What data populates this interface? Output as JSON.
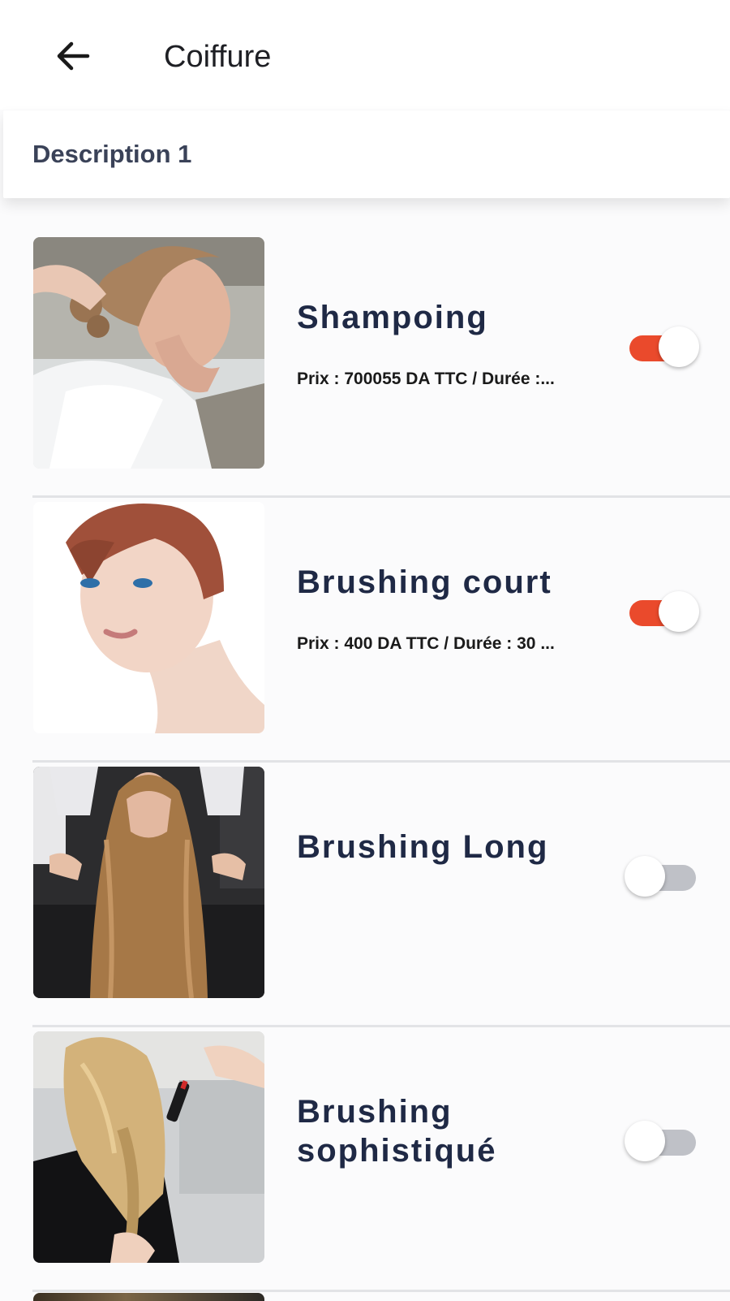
{
  "header": {
    "back_icon": "arrow-left-icon",
    "title": "Coiffure"
  },
  "description": {
    "label": "Description 1"
  },
  "services": [
    {
      "name": "Shampoing",
      "price": "Prix : 700055 DA TTC / Durée :...",
      "enabled": true,
      "image": "woman-hair-washing-photo"
    },
    {
      "name": "Brushing court",
      "price": "Prix : 400 DA TTC / Durée : 30 ...",
      "enabled": true,
      "image": "woman-short-hair-photo"
    },
    {
      "name": "Brushing Long",
      "price": "",
      "enabled": false,
      "image": "woman-long-hair-photo"
    },
    {
      "name": "Brushing sophistiqué",
      "price": "",
      "enabled": false,
      "image": "woman-braiding-hair-photo"
    }
  ],
  "colors": {
    "toggle_on": "#ea4a2c",
    "toggle_off": "#bfc1c7",
    "title_text": "#1f2945"
  }
}
